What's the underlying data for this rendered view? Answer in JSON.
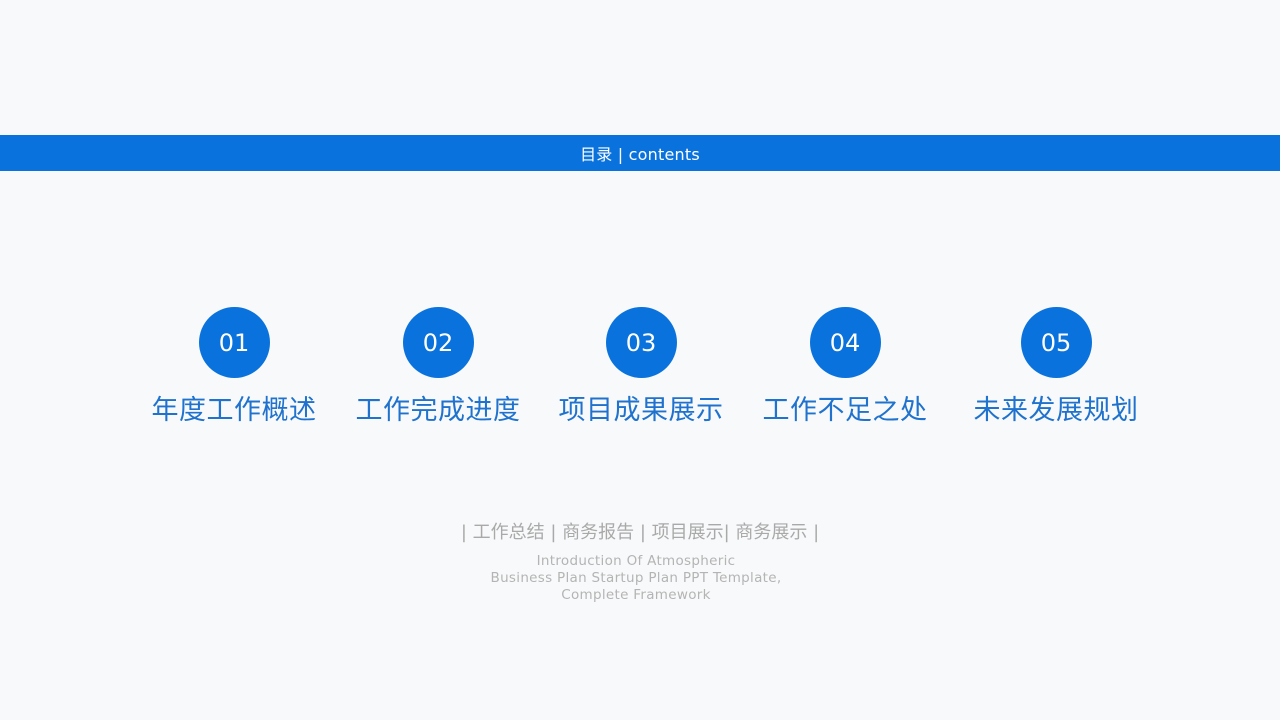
{
  "header": {
    "title": "目录 | contents"
  },
  "items": [
    {
      "number": "01",
      "label": "年度工作概述"
    },
    {
      "number": "02",
      "label": "工作完成进度"
    },
    {
      "number": "03",
      "label": "项目成果展示"
    },
    {
      "number": "04",
      "label": "工作不足之处"
    },
    {
      "number": "05",
      "label": "未来发展规划"
    }
  ],
  "footer": {
    "tagline": "| 工作总结 | 商务报告 | 项目展示| 商务展示 |",
    "description_lines": [
      "Introduction Of Atmospheric",
      "Business Plan Startup Plan PPT Template,",
      "Complete Framework"
    ]
  },
  "colors": {
    "accent": "#0a72dc",
    "label": "#1f72cd",
    "muted": "#a9a9a9",
    "background": "#f8f9fa"
  }
}
